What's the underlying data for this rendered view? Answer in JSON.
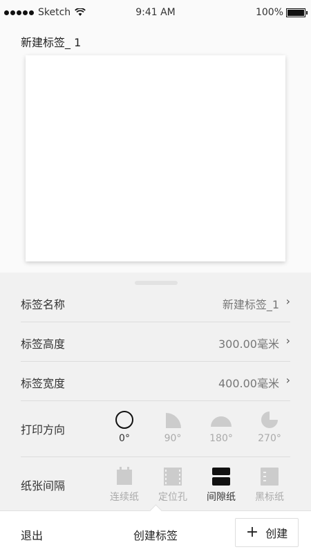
{
  "status_bar": {
    "carrier": "Sketch",
    "time": "9:41 AM",
    "battery": "100%"
  },
  "header": {
    "label_name": "新建标签_ 1"
  },
  "settings": {
    "name_row": {
      "label": "标签名称",
      "value": "新建标签_1",
      "chevron": "›"
    },
    "height_row": {
      "label": "标签高度",
      "value": "300.00毫米",
      "chevron": "›"
    },
    "width_row": {
      "label": "标签宽度",
      "value": "400.00毫米",
      "chevron": "›"
    },
    "direction_row": {
      "label": "打印方向",
      "options": [
        {
          "label": "0°",
          "icon": "circle-outline-icon",
          "selected": true
        },
        {
          "label": "90°",
          "icon": "quarter-circle-icon",
          "selected": false
        },
        {
          "label": "180°",
          "icon": "half-circle-icon",
          "selected": false
        },
        {
          "label": "270°",
          "icon": "three-quarter-circle-icon",
          "selected": false
        }
      ]
    },
    "gap_row": {
      "label": "纸张间隔",
      "options": [
        {
          "label": "连续纸",
          "icon": "continuous-paper-icon",
          "selected": false
        },
        {
          "label": "定位孔",
          "icon": "sprocket-hole-icon",
          "selected": false
        },
        {
          "label": "间隙纸",
          "icon": "gap-paper-icon",
          "selected": true
        },
        {
          "label": "黑标纸",
          "icon": "black-mark-paper-icon",
          "selected": false
        }
      ]
    }
  },
  "bottom_bar": {
    "exit_label": "退出",
    "title": "创建标签",
    "create_label": "创建",
    "create_icon": "plus-icon"
  },
  "colors": {
    "selected": "#111111",
    "unselected": "#cccccc",
    "panel_bg": "#f1f1f1"
  }
}
